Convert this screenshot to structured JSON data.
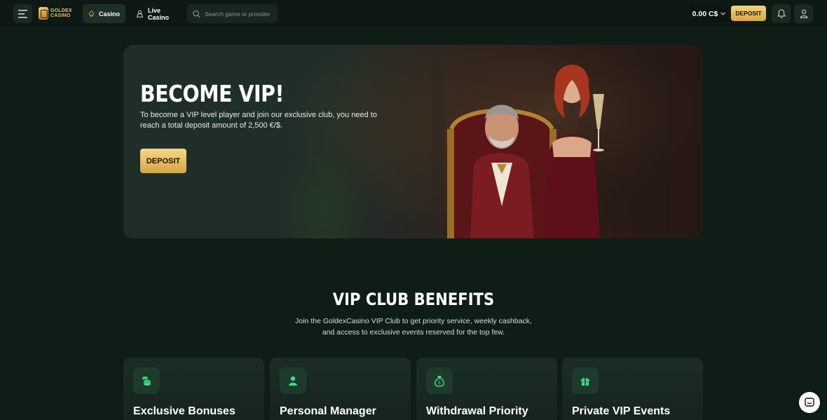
{
  "header": {
    "logo_text_line1": "GOLDEX",
    "logo_text_line2": "CASINO",
    "tabs": [
      {
        "label": "Casino",
        "icon": "spade-icon",
        "active": true
      },
      {
        "label": "Live Casino",
        "icon": "dealer-icon",
        "active": false
      }
    ],
    "search_placeholder": "Search game or provider",
    "balance": "0.00 C$",
    "deposit_label": "DEPOSIT"
  },
  "hero": {
    "title": "BECOME VIP!",
    "text": "To become a VIP level player and join our exclusive club, you need to reach a total deposit amount of 2,500 €/$.",
    "deposit_label": "DEPOSIT"
  },
  "benefits": {
    "title": "VIP CLUB BENEFITS",
    "text": "Join the GoldexCasino VIP Club to get priority service, weekly cashback, and access to exclusive events reserved for the top few.",
    "cards": [
      {
        "title": "Exclusive Bonuses",
        "icon": "coins-icon"
      },
      {
        "title": "Personal Manager",
        "icon": "manager-icon"
      },
      {
        "title": "Withdrawal Priority",
        "icon": "money-bag-icon"
      },
      {
        "title": "Private VIP Events",
        "icon": "gift-icon"
      }
    ]
  },
  "colors": {
    "background": "#0f1d17",
    "header": "#0e1915",
    "gold": "#d6a845",
    "accent_green": "#3ddc84"
  }
}
